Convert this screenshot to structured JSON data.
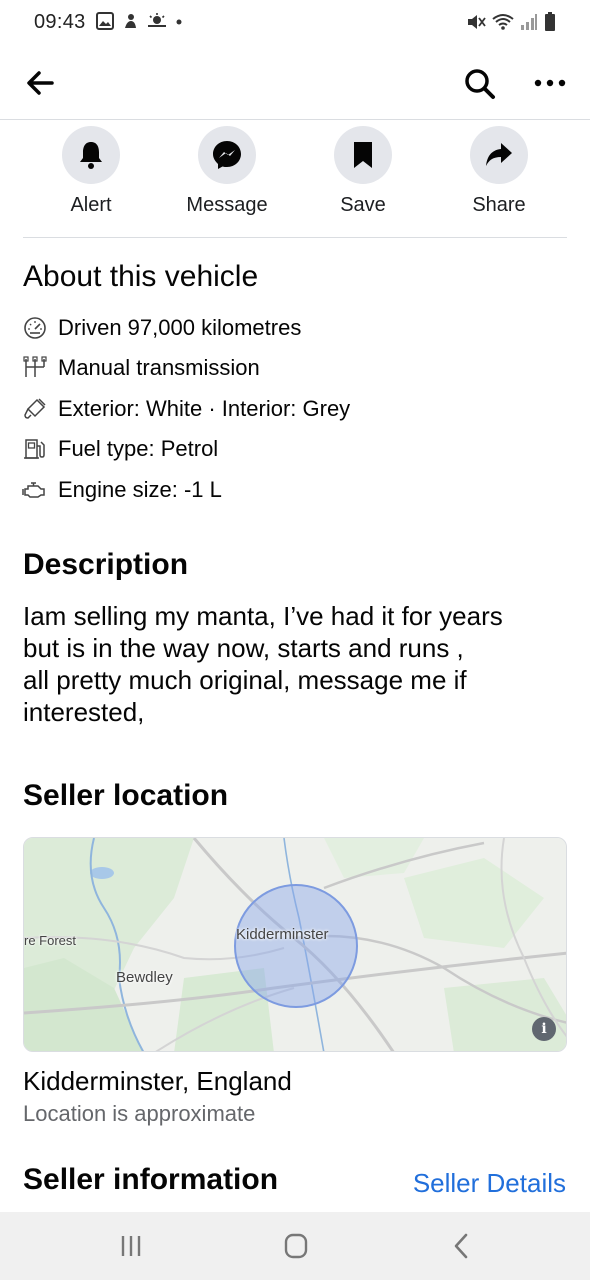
{
  "status_bar": {
    "time": "09:43",
    "icons": [
      "gallery-icon",
      "notification-icon",
      "weather-icon",
      "dot-icon",
      "mute-icon",
      "wifi-icon",
      "signal-icon",
      "battery-icon"
    ]
  },
  "top_bar": {
    "icons": [
      "back-arrow-icon",
      "search-icon",
      "more-options-icon"
    ]
  },
  "actions": [
    {
      "label": "Alert",
      "icon": "bell-icon"
    },
    {
      "label": "Message",
      "icon": "messenger-icon"
    },
    {
      "label": "Save",
      "icon": "bookmark-icon"
    },
    {
      "label": "Share",
      "icon": "share-arrow-icon"
    }
  ],
  "about": {
    "title": "About this vehicle",
    "specs": [
      {
        "icon": "speedometer-icon",
        "text": "Driven 97,000 kilometres"
      },
      {
        "icon": "gearbox-icon",
        "text": "Manual transmission"
      },
      {
        "icon": "paint-icon",
        "text": "Exterior: White · Interior: Grey"
      },
      {
        "icon": "fuel-pump-icon",
        "text": "Fuel type: Petrol"
      },
      {
        "icon": "engine-icon",
        "text": "Engine size: -1 L"
      }
    ]
  },
  "description": {
    "title": "Description",
    "text": "Iam selling my manta, I’ve had it for years\nbut is in the way now, starts and runs ,\nall pretty much original, message me if\ninterested,"
  },
  "seller_location": {
    "title": "Seller location",
    "map_labels": {
      "center": "Kidderminster",
      "west": "Bewdley",
      "far_west": "re Forest"
    },
    "place": "Kidderminster, England",
    "note": "Location is approximate"
  },
  "seller_information": {
    "title": "Seller information",
    "link": "Seller Details"
  },
  "nav_bar": {
    "icons": [
      "recent-apps-icon",
      "home-icon",
      "back-icon"
    ]
  },
  "colors": {
    "accent_link": "#216fdb",
    "action_circle": "#e4e6eb",
    "secondary_text": "#65676b",
    "map_circle": "#8aa7ea"
  }
}
